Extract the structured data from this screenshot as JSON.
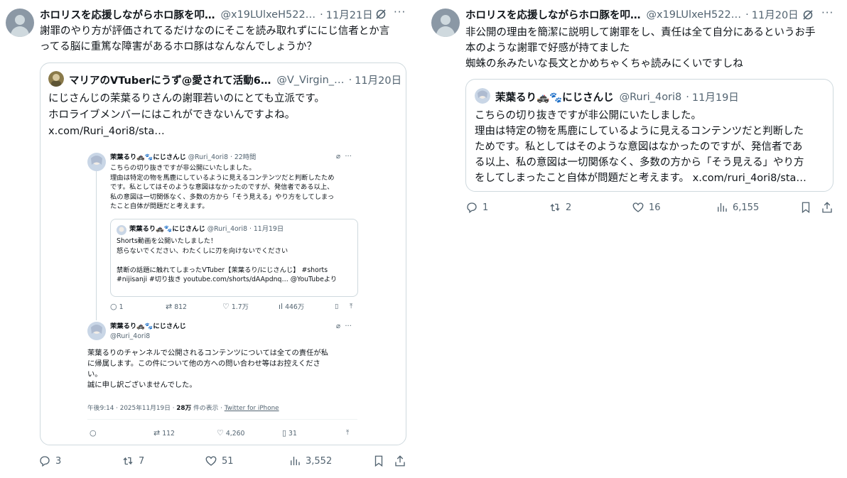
{
  "left": {
    "author_name": "ホロリスを応援しながらホロ豚を叩…",
    "handle": "@x19LUlxeH522…",
    "date": "11月21日",
    "text_lines": [
      "謝罪のやり方が評価されてるだけなのにそこを読み取れずににじ信者とか言",
      "ってる脳に重篤な障害があるホロ豚はなんなんでしょうか？"
    ],
    "quote": {
      "author_name": "マリアのVTuberにうず@愛されて活動6…",
      "handle": "@V_Virgin_…",
      "date": "11月20日",
      "text_lines": [
        "にじさんじの茉葉るりさんの謝罪若いのにとても立派です。",
        "ホロライブメンバーにはこれができないんですよね。",
        "x.com/Ruri_4ori8/sta…"
      ],
      "screenshot": {
        "post1": {
          "name": "茉葉るり🚓🐾にじさんじ",
          "handle": "@Ruri_4ori8",
          "time": "22時間",
          "lines": [
            "こちらの切り抜きですが非公開にいたしました。",
            "理由は特定の物を馬鹿にしているように見えるコンテンツだと判断したため",
            "です。私としてはそのような意図はなかったのですが、発信者である以上、",
            "私の意図は一切関係なく、多数の方から「そう見える」やり方をしてしまっ",
            "たこと自体が問題だと考えます。"
          ]
        },
        "inner_quote": {
          "name": "茉葉るり🚓🐾にじさんじ",
          "handle": "@Ruri_4ori8",
          "date": "11月19日",
          "lines": [
            "Shorts動画を公開いたしました！",
            "怒らないでください、わたくしに刃を向けないでください",
            "",
            "禁断の話題に触れてしまったVTuber【茉葉るり/にじさんじ】 #shorts",
            "#nijisanji #切り抜き youtube.com/shorts/dAApdnq… @YouTubeより"
          ]
        },
        "post1_stats": {
          "replies": "1",
          "retweets": "812",
          "likes": "1.7万",
          "views": "446万"
        },
        "post2": {
          "name": "茉葉るり🚓🐾にじさんじ",
          "handle": "@Ruri_4ori8",
          "lines": [
            "茉葉るりのチャンネルで公開されるコンテンツについては全ての責任が私",
            "に帰属します。この件について他の方への問い合わせ等はお控えくださ",
            "い。",
            "誠に申し訳ございませんでした。"
          ],
          "meta_time": "午後9:14 · 2025年11月19日 · ",
          "meta_views": "28万",
          "meta_views_suffix": " 件の表示 · ",
          "meta_source": "Twitter for iPhone"
        },
        "post2_stats": {
          "retweets": "112",
          "likes": "4,260",
          "bookmarks": "31"
        }
      }
    },
    "stats": {
      "replies": "3",
      "retweets": "7",
      "likes": "51",
      "views": "3,552"
    }
  },
  "right": {
    "author_name": "ホロリスを応援しながらホロ豚を叩…",
    "handle": "@x19LUlxeH522…",
    "date": "11月20日",
    "text_lines": [
      "非公開の理由を簡潔に説明して謝罪をし、責任は全て自分にあるというお手",
      "本のような謝罪で好感が持てました",
      "蜘蛛の糸みたいな長文とかめちゃくちゃ読みにくいですしね"
    ],
    "quote": {
      "author_name": "茉葉るり🚓🐾にじさんじ",
      "handle": "@Ruri_4ori8",
      "date": "11月19日",
      "text_lines": [
        "こちらの切り抜きですが非公開にいたしました。",
        "理由は特定の物を馬鹿にしているように見えるコンテンツだと判断した",
        "ためです。私としてはそのような意図はなかったのですが、発信者であ",
        "る以上、私の意図は一切関係なく、多数の方から「そう見える」やり方",
        "をしてしまったこと自体が問題だと考えます。 x.com/ruri_4ori8/sta…"
      ]
    },
    "stats": {
      "replies": "1",
      "retweets": "2",
      "likes": "16",
      "views": "6,155"
    }
  },
  "icons": [
    "grok-icon",
    "more-icon",
    "reply-icon",
    "retweet-icon",
    "like-icon",
    "views-icon",
    "bookmark-icon",
    "share-icon"
  ]
}
